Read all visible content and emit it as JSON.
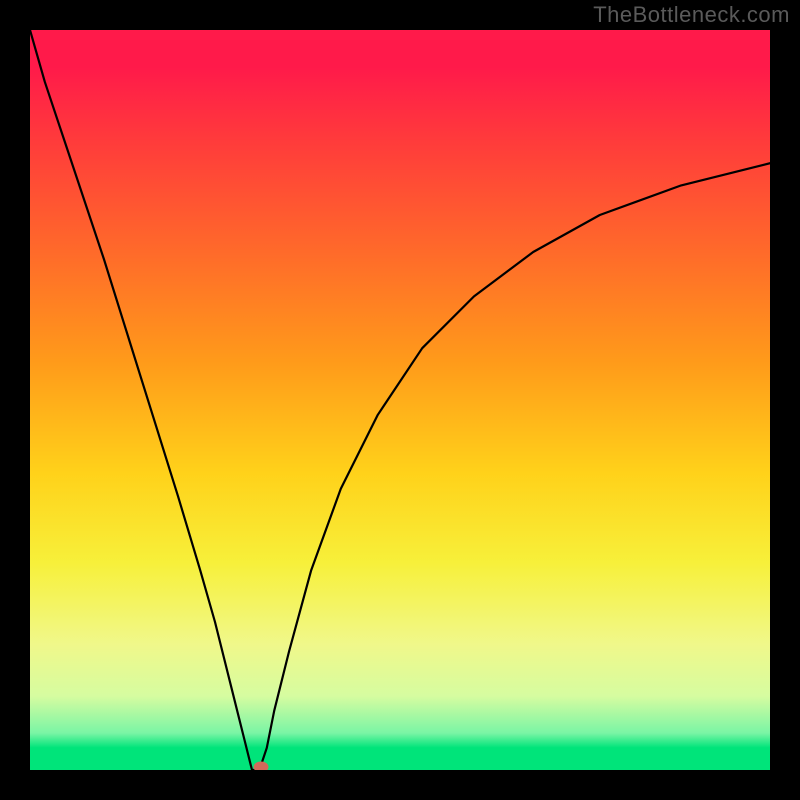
{
  "watermark": "TheBottleneck.com",
  "colors": {
    "frame_bg": "#000000",
    "gradient_top": "#ff1a4a",
    "gradient_mid1": "#ff9b1a",
    "gradient_mid2": "#f7f03a",
    "gradient_bottom": "#00e47a",
    "curve": "#000000",
    "marker": "#d06a5a",
    "watermark": "#5a5a5a"
  },
  "chart_data": {
    "type": "line",
    "title": "",
    "xlabel": "",
    "ylabel": "",
    "xlim": [
      0,
      100
    ],
    "ylim": [
      0,
      100
    ],
    "series": [
      {
        "name": "bottleneck-curve",
        "x": [
          0,
          2,
          5,
          10,
          15,
          20,
          23,
          25,
          27,
          28,
          29,
          30,
          31,
          32,
          33,
          35,
          38,
          42,
          47,
          53,
          60,
          68,
          77,
          88,
          100
        ],
        "y": [
          100,
          93,
          84,
          69,
          53,
          37,
          27,
          20,
          12,
          8,
          4,
          0,
          0,
          3,
          8,
          16,
          27,
          38,
          48,
          57,
          64,
          70,
          75,
          79,
          82
        ],
        "note": "y is bottleneck percentage; 0 is at the bottom (green), 100 at the top (red). Curve dips to a near-zero minimum around x≈30 then rises again."
      }
    ],
    "marker": {
      "x": 31.2,
      "y": 0
    },
    "annotations": []
  }
}
